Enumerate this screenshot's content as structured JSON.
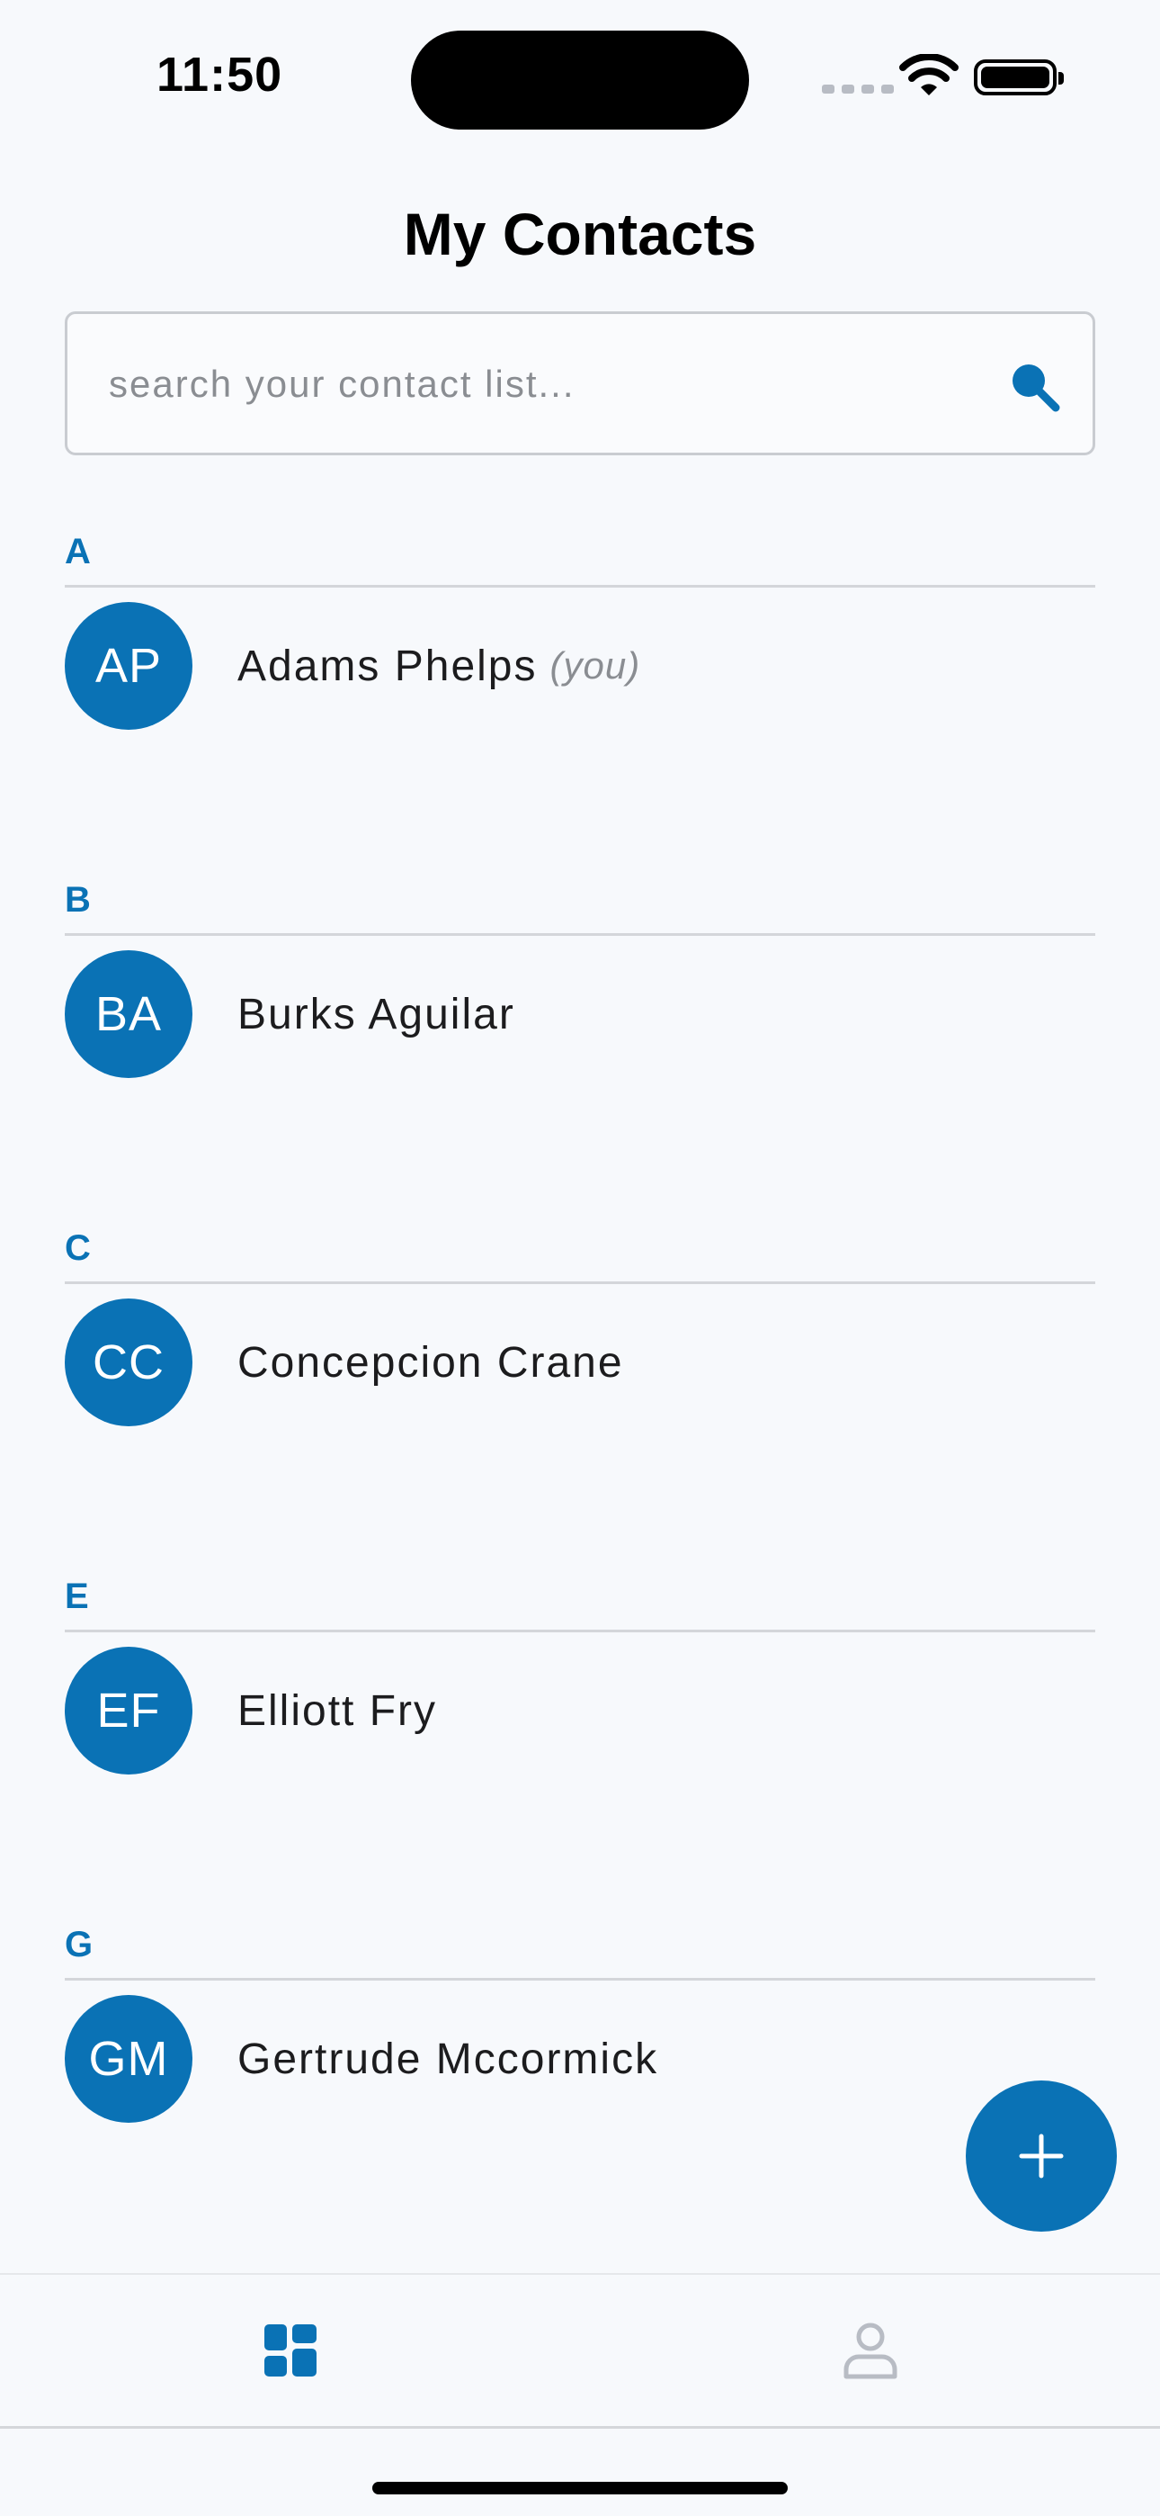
{
  "status_bar": {
    "time": "11:50"
  },
  "header": {
    "title": "My Contacts"
  },
  "search": {
    "placeholder": "search your contact list...",
    "value": "",
    "icon": "search-icon"
  },
  "sections": [
    {
      "letter": "A",
      "contacts": [
        {
          "initials": "AP",
          "name": "Adams Phelps",
          "suffix": "(you)"
        }
      ]
    },
    {
      "letter": "B",
      "contacts": [
        {
          "initials": "BA",
          "name": "Burks Aguilar"
        }
      ]
    },
    {
      "letter": "C",
      "contacts": [
        {
          "initials": "CC",
          "name": "Concepcion Crane"
        }
      ]
    },
    {
      "letter": "E",
      "contacts": [
        {
          "initials": "EF",
          "name": "Elliott Fry"
        }
      ]
    },
    {
      "letter": "G",
      "contacts": [
        {
          "initials": "GM",
          "name": "Gertrude Mccormick"
        }
      ]
    }
  ],
  "fab": {
    "icon": "plus-icon"
  },
  "tabbar": {
    "tabs": [
      {
        "icon": "grid-icon",
        "active": true
      },
      {
        "icon": "person-icon",
        "active": false
      }
    ]
  },
  "colors": {
    "accent": "#0a72b5",
    "background": "#f7f9fc",
    "inactive": "#b8bcc4"
  }
}
